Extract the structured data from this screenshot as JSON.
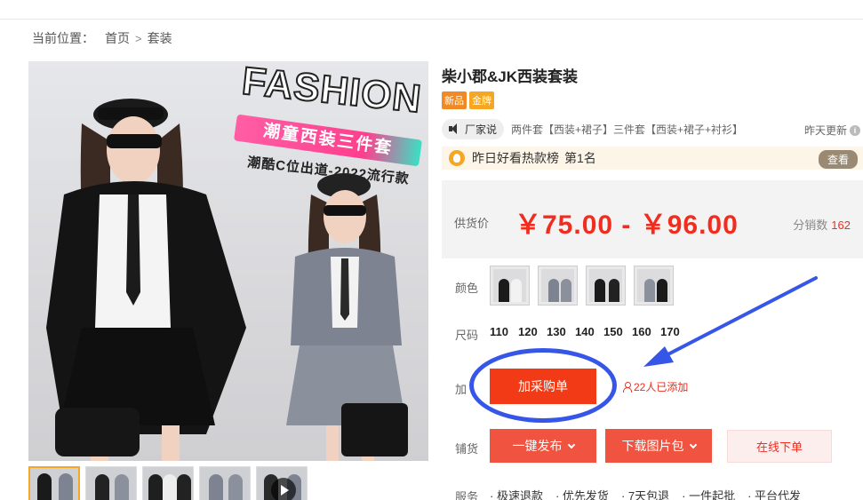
{
  "breadcrumb": {
    "prefix": "当前位置：",
    "home": "首页",
    "category": "套装"
  },
  "main_image": {
    "fashion": "FASHION",
    "ribbon": "潮童西装三件套",
    "tagline": "潮酷C位出道-2022流行款"
  },
  "product": {
    "title": "柴小郡&JK西装套装",
    "badges": [
      "新品",
      "金牌"
    ],
    "factory_button": "厂家说",
    "variants": "两件套【西装+裙子】三件套【西装+裙子+衬衫】",
    "updated": "昨天更新",
    "rank_text": "昨日好看热款榜",
    "rank_position": "第1名",
    "view_button": "查看"
  },
  "price": {
    "label": "供货价",
    "range": "￥75.00 - ￥96.00",
    "sales_label": "分销数",
    "sales_count": "162"
  },
  "options": {
    "color_label": "颜色",
    "size_label": "尺码",
    "sizes": [
      "110",
      "120",
      "130",
      "140",
      "150",
      "160",
      "170"
    ]
  },
  "actions": {
    "add_label_partial": "加",
    "add_button": "加采购单",
    "added_count": "22人已添加",
    "publish_label": "铺货",
    "publish_button": "一键发布",
    "download_button": "下载图片包",
    "online_button": "在线下单"
  },
  "services": {
    "label": "服务",
    "items": [
      "极速退款",
      "优先发货",
      "7天包退",
      "一件起批",
      "平台代发"
    ]
  },
  "colors": {
    "accent": "#f02d1e",
    "button": "#f23b16",
    "annotation": "#3656e8",
    "badge_new": "#f08a24",
    "badge_gold": "#f5a623"
  }
}
